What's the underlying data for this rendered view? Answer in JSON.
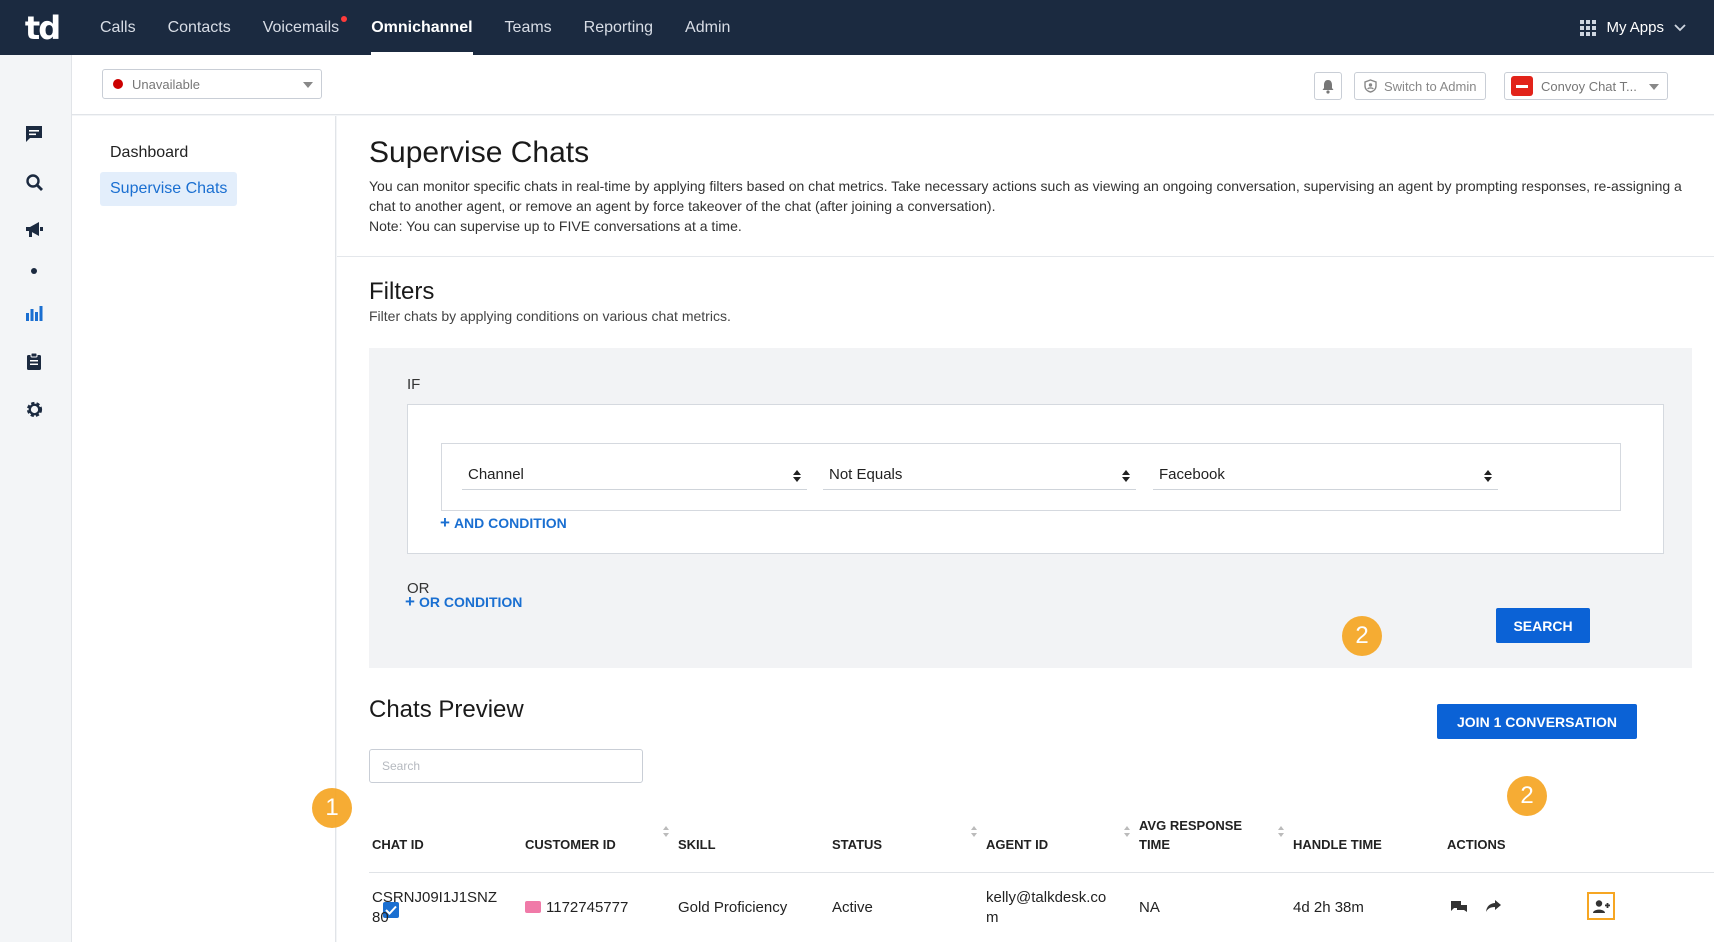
{
  "topnav": {
    "logo": "td",
    "items": [
      {
        "label": "Calls"
      },
      {
        "label": "Contacts"
      },
      {
        "label": "Voicemails"
      },
      {
        "label": "Omnichannel"
      },
      {
        "label": "Teams"
      },
      {
        "label": "Reporting"
      },
      {
        "label": "Admin"
      }
    ],
    "active_item": "Omnichannel",
    "my_apps": "My Apps"
  },
  "rail": {
    "icons": [
      "chat-icon",
      "search-icon",
      "megaphone-icon",
      "dot-icon",
      "bar-chart-icon",
      "clipboard-icon",
      "gear-icon"
    ]
  },
  "subheader": {
    "status": "Unavailable",
    "switch_label": "Switch to Admin",
    "app_label": "Convoy Chat T...",
    "colors": {
      "status_dot": "#cc0000",
      "convoy_brand": "#e2231a"
    }
  },
  "sidebar": {
    "items": [
      {
        "label": "Dashboard"
      },
      {
        "label": "Supervise Chats"
      }
    ],
    "active_item": "Supervise Chats"
  },
  "main": {
    "title": "Supervise Chats",
    "description_line1": "You can monitor specific chats in real-time by applying filters based on chat metrics. Take necessary actions such as viewing an ongoing conversation, supervising an agent by prompting responses, re-assigning a",
    "description_line2": "chat to another agent, or remove an agent by force takeover of the chat (after joining a conversation).",
    "description_note": "Note: You can supervise up to FIVE conversations at a time.",
    "filters": {
      "title": "Filters",
      "description": "Filter chats by applying conditions on various chat metrics.",
      "if_label": "IF",
      "condition": {
        "field": "Channel",
        "operator": "Not Equals",
        "value": "Facebook"
      },
      "and_condition": "AND CONDITION",
      "or_label": "OR",
      "or_condition": "OR CONDITION",
      "search_button": "SEARCH"
    },
    "preview": {
      "title": "Chats Preview",
      "join_button": "JOIN 1 CONVERSATION",
      "search_placeholder": "Search",
      "columns": {
        "chat_id": "CHAT ID",
        "customer_id": "CUSTOMER ID",
        "skill": "SKILL",
        "status": "STATUS",
        "agent_id": "AGENT ID",
        "avg_response_1": "AVG RESPONSE",
        "avg_response_2": "TIME",
        "handle_time": "HANDLE TIME",
        "actions": "ACTIONS"
      },
      "rows": [
        {
          "selected": true,
          "chat_id_1": "CSRNJ09I1J1SNZ",
          "chat_id_2": "80",
          "customer_id": "1172745777",
          "skill": "Gold Proficiency",
          "status": "Active",
          "agent_id_1": "kelly@talkdesk.co",
          "agent_id_2": "m",
          "avg_response": "NA",
          "handle_time": "4d 2h 38m",
          "actions": [
            "chat-bubbles-icon",
            "forward-arrow-icon",
            "add-user-icon"
          ]
        }
      ]
    }
  },
  "annotations": {
    "step_1": "1",
    "step_2a": "2",
    "step_2b": "2",
    "color": "#f6a623"
  }
}
